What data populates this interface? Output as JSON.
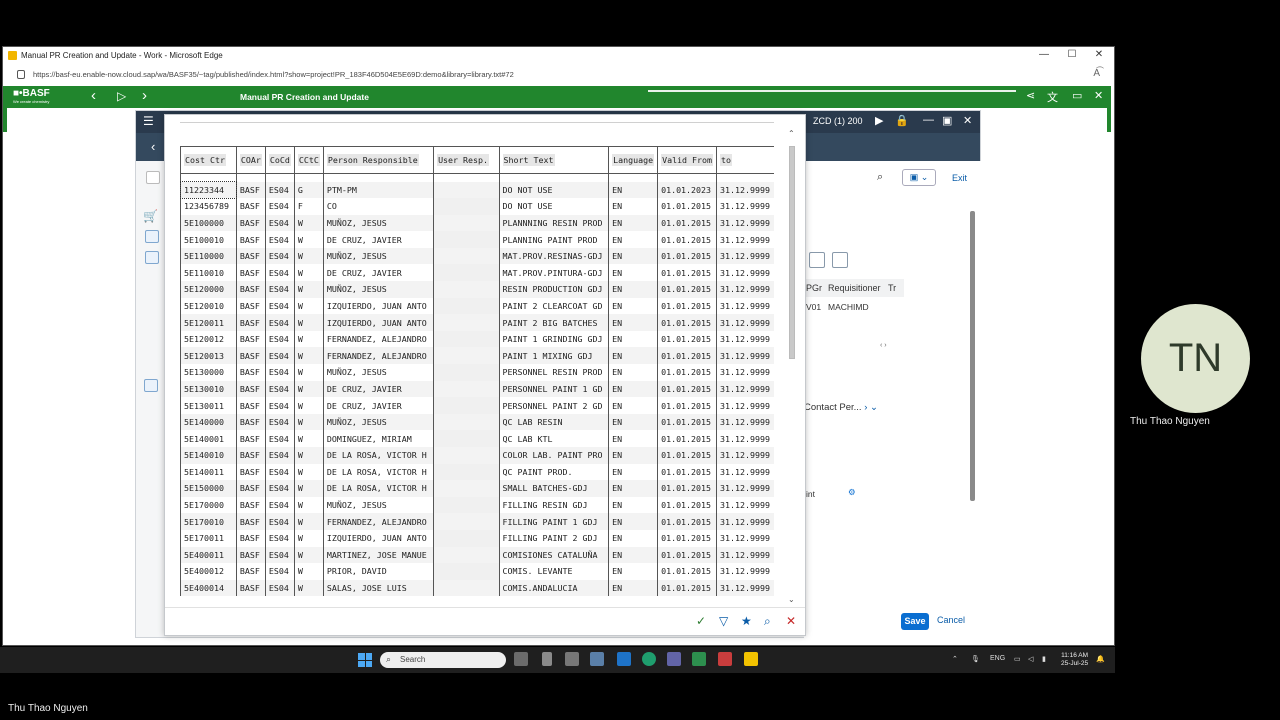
{
  "window": {
    "title": "Manual PR Creation and Update - Work - Microsoft Edge",
    "url": "https://basf-eu.enable-now.cloud.sap/wa/BASF35/~tag/published/index.html?show=project!PR_183F46D504E5E69D:demo&library=library.txt#72"
  },
  "basf": {
    "logo": "■•BASF",
    "tagline": "We create chemistry",
    "title": "Manual PR Creation and Update"
  },
  "sap": {
    "session": "ZCD (1) 200",
    "exit": "Exit",
    "save": "Save",
    "cancel": "Cancel",
    "right_headers": {
      "pgr": "PGr",
      "requisitioner": "Requisitioner",
      "tr": "Tr"
    },
    "right_row": {
      "pgr": "V01",
      "requisitioner": "MACHIMD"
    },
    "contact": "Contact Per...",
    "int_label": "int"
  },
  "f4": {
    "headers": [
      "Cost Ctr",
      "COAr",
      "CoCd",
      "CCtC",
      "Person Responsible",
      "User Resp.",
      "Short Text",
      "Language",
      "Valid From",
      "to"
    ],
    "rows": [
      [
        "11223344",
        "BASF",
        "ES04",
        "G",
        "PTM-PM",
        "",
        "DO NOT USE",
        "EN",
        "01.01.2023",
        "31.12.9999"
      ],
      [
        "123456789",
        "BASF",
        "ES04",
        "F",
        "CO",
        "",
        "DO NOT USE",
        "EN",
        "01.01.2015",
        "31.12.9999"
      ],
      [
        "5E100000",
        "BASF",
        "ES04",
        "W",
        "MUÑOZ, JESUS",
        "",
        "PLANNNING RESIN PROD",
        "EN",
        "01.01.2015",
        "31.12.9999"
      ],
      [
        "5E100010",
        "BASF",
        "ES04",
        "W",
        "DE CRUZ, JAVIER",
        "",
        "PLANNING PAINT PROD",
        "EN",
        "01.01.2015",
        "31.12.9999"
      ],
      [
        "5E110000",
        "BASF",
        "ES04",
        "W",
        "MUÑOZ, JESUS",
        "",
        "MAT.PROV.RESINAS-GDJ",
        "EN",
        "01.01.2015",
        "31.12.9999"
      ],
      [
        "5E110010",
        "BASF",
        "ES04",
        "W",
        "DE CRUZ, JAVIER",
        "",
        "MAT.PROV.PINTURA-GDJ",
        "EN",
        "01.01.2015",
        "31.12.9999"
      ],
      [
        "5E120000",
        "BASF",
        "ES04",
        "W",
        "MUÑOZ, JESUS",
        "",
        "RESIN PRODUCTION GDJ",
        "EN",
        "01.01.2015",
        "31.12.9999"
      ],
      [
        "5E120010",
        "BASF",
        "ES04",
        "W",
        "IZQUIERDO, JUAN ANTO",
        "",
        "PAINT 2 CLEARCOAT GD",
        "EN",
        "01.01.2015",
        "31.12.9999"
      ],
      [
        "5E120011",
        "BASF",
        "ES04",
        "W",
        "IZQUIERDO, JUAN ANTO",
        "",
        "PAINT 2 BIG BATCHES",
        "EN",
        "01.01.2015",
        "31.12.9999"
      ],
      [
        "5E120012",
        "BASF",
        "ES04",
        "W",
        "FERNANDEZ, ALEJANDRO",
        "",
        "PAINT 1 GRINDING GDJ",
        "EN",
        "01.01.2015",
        "31.12.9999"
      ],
      [
        "5E120013",
        "BASF",
        "ES04",
        "W",
        "FERNANDEZ, ALEJANDRO",
        "",
        "PAINT 1 MIXING GDJ",
        "EN",
        "01.01.2015",
        "31.12.9999"
      ],
      [
        "5E130000",
        "BASF",
        "ES04",
        "W",
        "MUÑOZ, JESUS",
        "",
        "PERSONNEL RESIN PROD",
        "EN",
        "01.01.2015",
        "31.12.9999"
      ],
      [
        "5E130010",
        "BASF",
        "ES04",
        "W",
        "DE CRUZ, JAVIER",
        "",
        "PERSONNEL PAINT 1 GD",
        "EN",
        "01.01.2015",
        "31.12.9999"
      ],
      [
        "5E130011",
        "BASF",
        "ES04",
        "W",
        "DE CRUZ, JAVIER",
        "",
        "PERSONNEL PAINT 2 GD",
        "EN",
        "01.01.2015",
        "31.12.9999"
      ],
      [
        "5E140000",
        "BASF",
        "ES04",
        "W",
        "MUÑOZ, JESUS",
        "",
        "QC LAB RESIN",
        "EN",
        "01.01.2015",
        "31.12.9999"
      ],
      [
        "5E140001",
        "BASF",
        "ES04",
        "W",
        "DOMINGUEZ, MIRIAM",
        "",
        "QC LAB KTL",
        "EN",
        "01.01.2015",
        "31.12.9999"
      ],
      [
        "5E140010",
        "BASF",
        "ES04",
        "W",
        "DE LA ROSA, VICTOR H",
        "",
        "COLOR LAB. PAINT PRO",
        "EN",
        "01.01.2015",
        "31.12.9999"
      ],
      [
        "5E140011",
        "BASF",
        "ES04",
        "W",
        "DE LA ROSA, VICTOR H",
        "",
        "QC PAINT PROD.",
        "EN",
        "01.01.2015",
        "31.12.9999"
      ],
      [
        "5E150000",
        "BASF",
        "ES04",
        "W",
        "DE LA ROSA, VICTOR H",
        "",
        "SMALL BATCHES-GDJ",
        "EN",
        "01.01.2015",
        "31.12.9999"
      ],
      [
        "5E170000",
        "BASF",
        "ES04",
        "W",
        "MUÑOZ, JESUS",
        "",
        "FILLING RESIN GDJ",
        "EN",
        "01.01.2015",
        "31.12.9999"
      ],
      [
        "5E170010",
        "BASF",
        "ES04",
        "W",
        "FERNANDEZ, ALEJANDRO",
        "",
        "FILLING PAINT 1 GDJ",
        "EN",
        "01.01.2015",
        "31.12.9999"
      ],
      [
        "5E170011",
        "BASF",
        "ES04",
        "W",
        "IZQUIERDO, JUAN ANTO",
        "",
        "FILLING PAINT 2 GDJ",
        "EN",
        "01.01.2015",
        "31.12.9999"
      ],
      [
        "5E400011",
        "BASF",
        "ES04",
        "W",
        "MARTINEZ, JOSE MANUE",
        "",
        "COMISIONES CATALUÑA",
        "EN",
        "01.01.2015",
        "31.12.9999"
      ],
      [
        "5E400012",
        "BASF",
        "ES04",
        "W",
        "PRIOR, DAVID",
        "",
        "COMIS. LEVANTE",
        "EN",
        "01.01.2015",
        "31.12.9999"
      ],
      [
        "5E400014",
        "BASF",
        "ES04",
        "W",
        "SALAS, JOSE LUIS",
        "",
        "COMIS.ANDALUCIA",
        "EN",
        "01.01.2015",
        "31.12.9999"
      ]
    ]
  },
  "meeting": {
    "participant_initials": "TN",
    "participant_name": "Thu Thao Nguyen",
    "presenter_name": "Thu Thao Nguyen"
  },
  "taskbar": {
    "search": "Search",
    "lang": "ENG",
    "time": "11:16 AM",
    "date": "25-Jul-25"
  },
  "colors": {
    "basf_green": "#21862d",
    "sap_blue": "#0a6ed1"
  }
}
